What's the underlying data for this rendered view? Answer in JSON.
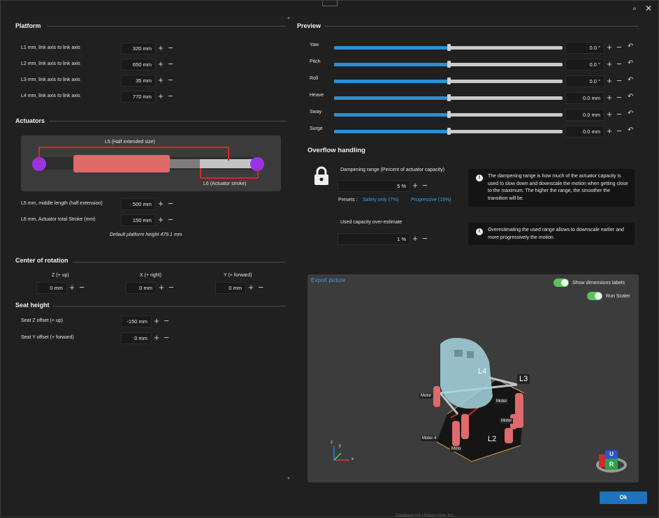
{
  "platform": {
    "title": "Platform",
    "rows": [
      {
        "label": "L1 mm, link axis to link axis",
        "value": "320 mm"
      },
      {
        "label": "L2 mm, link axis to link axis",
        "value": "650 mm"
      },
      {
        "label": "L3 mm, link axis to link axis",
        "value": "35 mm"
      },
      {
        "label": "L4 mm, link axis to link axis",
        "value": "770 mm"
      }
    ]
  },
  "actuators": {
    "title": "Actuators",
    "l5_caption": "L5 (Half extended size)",
    "l6_caption": "L6 (Actuator stroke)",
    "rows": [
      {
        "label": "L5 mm, middle length (half extension)",
        "value": "500 mm"
      },
      {
        "label": "L6 mm, Actuator total Stroke (mm)",
        "value": "150 mm"
      }
    ],
    "default_height": "Default platform height 479.1 mm"
  },
  "center": {
    "title": "Center of rotation",
    "cols": [
      {
        "label": "Z (+ up)",
        "value": "0 mm"
      },
      {
        "label": "X (+ right)",
        "value": "0 mm"
      },
      {
        "label": "Y (+ forward)",
        "value": "0 mm"
      }
    ]
  },
  "seat": {
    "title": "Seat height",
    "rows": [
      {
        "label": "Seat Z offset (+ up)",
        "value": "-150 mm"
      },
      {
        "label": "Seat Y offset (+ forward)",
        "value": "0 mm"
      }
    ]
  },
  "preview": {
    "title": "Preview",
    "sliders": [
      {
        "label": "Yaw",
        "value": "0.0 °",
        "level": 0.5
      },
      {
        "label": "Pitch",
        "value": "0.0 °",
        "level": 0.5
      },
      {
        "label": "Roll",
        "value": "0.0 °",
        "level": 0.5
      },
      {
        "label": "Heave",
        "value": "0.0 mm",
        "level": 0.5
      },
      {
        "label": "Sway",
        "value": "0.0 mm",
        "level": 0.5
      },
      {
        "label": "Surge",
        "value": "0.0 mm",
        "level": 0.5
      }
    ]
  },
  "overflow": {
    "title": "Overflow handling",
    "dampening_label": "Dampening range (Percent of actuator capacity)",
    "dampening_value": "5 %",
    "presets_label": "Presets :",
    "preset_safety": "Safety only (7%)",
    "preset_progressive": "Progressive (15%)",
    "info1": "The dampening range is how much of the actuator capacity is used to slow down and downscale the motion when getting close to the maximum. The higher the range, the smoother the transition will be.",
    "overestimate_label": "Used capacity over-estimate",
    "overestimate_value": "1 %",
    "info2": "Overestimating the used range allows to downscale earlier and more progressively the motion."
  },
  "viewport": {
    "export": "Export picture",
    "show_dims": "Show dimensions labels",
    "run_scaler": "Run Scaler",
    "labels": {
      "l4": "L4",
      "l3": "L3",
      "l2": "L2",
      "l1": "L",
      "motor": "Motor",
      "motor4": "Motor 4",
      "motor_short": "Moto"
    },
    "gizmo": {
      "up": "U",
      "right": "R",
      "x": "x",
      "y": "y",
      "z": "z"
    }
  },
  "ok": "Ok",
  "bg_text": "Database-mit-Umbau-neue-Ins..."
}
